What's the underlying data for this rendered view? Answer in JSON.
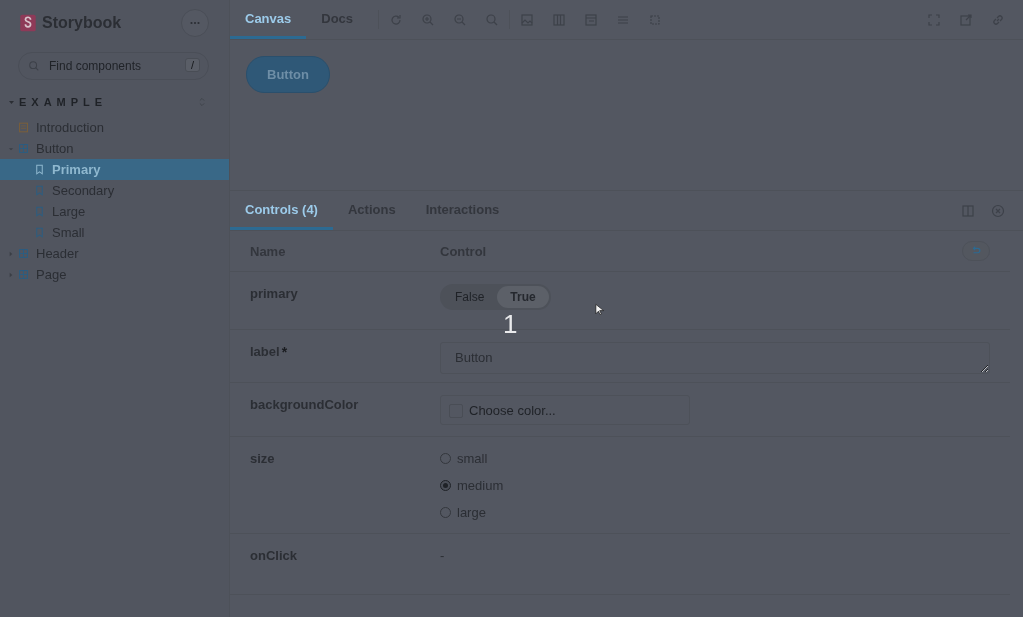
{
  "sidebar": {
    "brand": "Storybook",
    "search": {
      "placeholder": "Find components",
      "shortcut": "/"
    },
    "section": {
      "label": "EXAMPLE",
      "expanded": true
    },
    "tree": [
      {
        "label": "Introduction",
        "kind": "doc",
        "selected": false
      },
      {
        "label": "Button",
        "kind": "component",
        "expanded": true,
        "selected": false,
        "children": [
          {
            "label": "Primary",
            "kind": "story",
            "selected": true
          },
          {
            "label": "Secondary",
            "kind": "story",
            "selected": false
          },
          {
            "label": "Large",
            "kind": "story",
            "selected": false
          },
          {
            "label": "Small",
            "kind": "story",
            "selected": false
          }
        ]
      },
      {
        "label": "Header",
        "kind": "component",
        "expanded": false,
        "selected": false
      },
      {
        "label": "Page",
        "kind": "component",
        "expanded": false,
        "selected": false
      }
    ]
  },
  "toolbar": {
    "tabs": [
      {
        "label": "Canvas",
        "selected": true
      },
      {
        "label": "Docs",
        "selected": false
      }
    ]
  },
  "preview": {
    "button": {
      "label": "Button"
    }
  },
  "addons": {
    "tabs": [
      {
        "label": "Controls (4)",
        "selected": true
      },
      {
        "label": "Actions",
        "selected": false
      },
      {
        "label": "Interactions",
        "selected": false
      }
    ],
    "columns": [
      "Name",
      "Control"
    ],
    "rows": [
      {
        "name": "primary",
        "kind": "boolean",
        "options": [
          {
            "label": "False",
            "selected": false
          },
          {
            "label": "True",
            "selected": true
          }
        ]
      },
      {
        "name": "label",
        "required": "*",
        "kind": "text",
        "value": "Button"
      },
      {
        "name": "backgroundColor",
        "kind": "color",
        "placeholder": "Choose color..."
      },
      {
        "name": "size",
        "kind": "radio",
        "options": [
          {
            "label": "small",
            "selected": false
          },
          {
            "label": "medium",
            "selected": true
          },
          {
            "label": "large",
            "selected": false
          }
        ]
      },
      {
        "name": "onClick",
        "kind": "plain",
        "value": "-"
      }
    ]
  },
  "overlay": {
    "step_marker": "1"
  }
}
